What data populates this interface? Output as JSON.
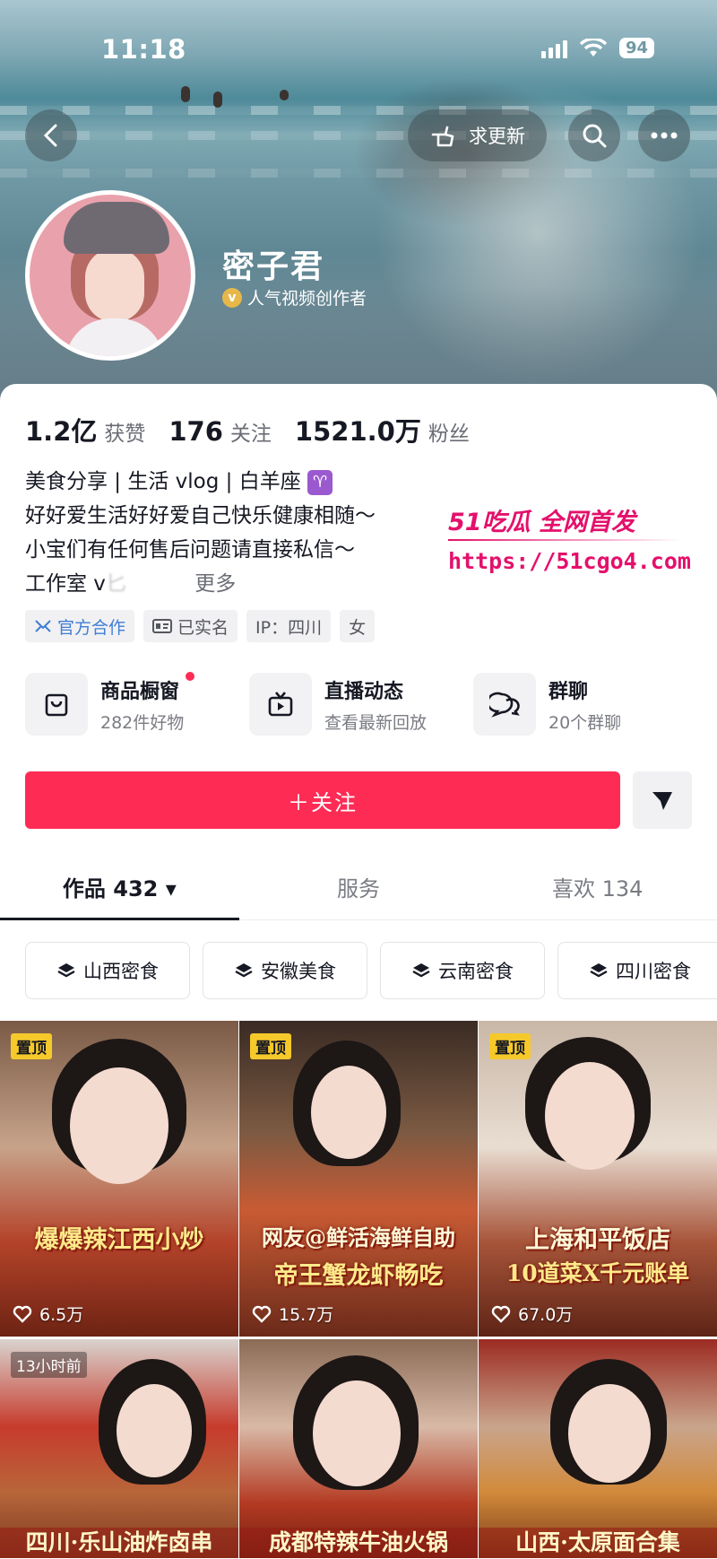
{
  "status_bar": {
    "time": "11:18",
    "battery": "94"
  },
  "header": {
    "request_update_label": "求更新",
    "nickname": "密子君",
    "creator_label": "人气视频创作者"
  },
  "stats": [
    {
      "value": "1.2亿",
      "label": "获赞"
    },
    {
      "value": "176",
      "label": "关注"
    },
    {
      "value": "1521.0万",
      "label": "粉丝"
    }
  ],
  "bio": {
    "line1": "美食分享 | 生活 vlog | 白羊座",
    "zodiac_symbol": "♈",
    "line2": "好好爱生活好好爱自己快乐健康相随～",
    "line3": "小宝们有任何售后问题请直接私信～",
    "line4": "工作室 v",
    "line4_obscured": "匕　　　",
    "more": "更多"
  },
  "tags": [
    {
      "label": "官方合作",
      "icon": "official-icon"
    },
    {
      "label": "已实名",
      "icon": "id-card-icon"
    },
    {
      "label": "IP：四川",
      "icon": ""
    },
    {
      "label": "女",
      "icon": ""
    }
  ],
  "services": [
    {
      "title": "商品橱窗",
      "subtitle": "282件好物",
      "icon": "shop-bag-icon",
      "has_dot": true
    },
    {
      "title": "直播动态",
      "subtitle": "查看最新回放",
      "icon": "tv-icon",
      "has_dot": false
    },
    {
      "title": "群聊",
      "subtitle": "20个群聊",
      "icon": "chat-bubbles-icon",
      "has_dot": false
    }
  ],
  "follow_label": "＋关注",
  "tabs": [
    {
      "label": "作品 432 ▾"
    },
    {
      "label": "服务"
    },
    {
      "label": "喜欢 134"
    }
  ],
  "collections": [
    {
      "label": "山西密食"
    },
    {
      "label": "安徽美食"
    },
    {
      "label": "云南密食"
    },
    {
      "label": "四川密食"
    }
  ],
  "videos": [
    {
      "badge": "置顶",
      "caption1": "",
      "caption2": "爆爆辣江西小炒",
      "likes": "6.5万"
    },
    {
      "badge": "置顶",
      "caption1": "网友@鲜活海鲜自助",
      "caption2": "帝王蟹龙虾畅吃",
      "likes": "15.7万"
    },
    {
      "badge": "置顶",
      "caption1": "上海和平饭店",
      "caption2": "10道菜X千元账单",
      "likes": "67.0万"
    },
    {
      "badge": "13小时前",
      "caption1": "",
      "caption2": "四川·乐山油炸卤串",
      "likes": ""
    },
    {
      "badge": "",
      "caption1": "",
      "caption2": "成都特辣牛油火锅",
      "likes": ""
    },
    {
      "badge": "",
      "caption1": "",
      "caption2": "山西·太原面合集",
      "likes": ""
    }
  ],
  "watermark": {
    "title": "51吃瓜 全网首发",
    "url": "https://51cgo4.com"
  },
  "colors": {
    "accent": "#fe2c55",
    "pin_badge": "#f6c92b",
    "watermark": "#e4106b"
  }
}
